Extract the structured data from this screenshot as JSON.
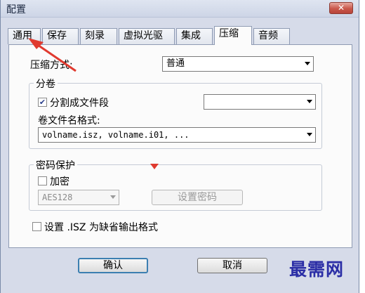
{
  "window": {
    "title": "配置",
    "close_label": "✕"
  },
  "tabs": [
    {
      "label": "通用"
    },
    {
      "label": "保存"
    },
    {
      "label": "刻录"
    },
    {
      "label": "虚拟光驱"
    },
    {
      "label": "集成"
    },
    {
      "label": "压缩",
      "active": true
    },
    {
      "label": "音频"
    }
  ],
  "compression": {
    "method_label": "压缩方式:",
    "method_value": "普通"
  },
  "split": {
    "group_title": "分卷",
    "split_checkbox_label": "分割成文件段",
    "split_checked": true,
    "size_value": "",
    "format_label": "卷文件名格式:",
    "format_value": "volname.isz, volname.i01, ..."
  },
  "password": {
    "group_title": "密码保护",
    "encrypt_label": "加密",
    "encrypt_checked": false,
    "algorithm_value": "AES128",
    "set_password_label": "设置密码"
  },
  "default_format": {
    "label": "设置 .ISZ 为缺省输出格式",
    "checked": false
  },
  "buttons": {
    "ok": "确认",
    "cancel": "取消"
  },
  "annotation_color": "#e03a2f",
  "watermark": "最需网"
}
